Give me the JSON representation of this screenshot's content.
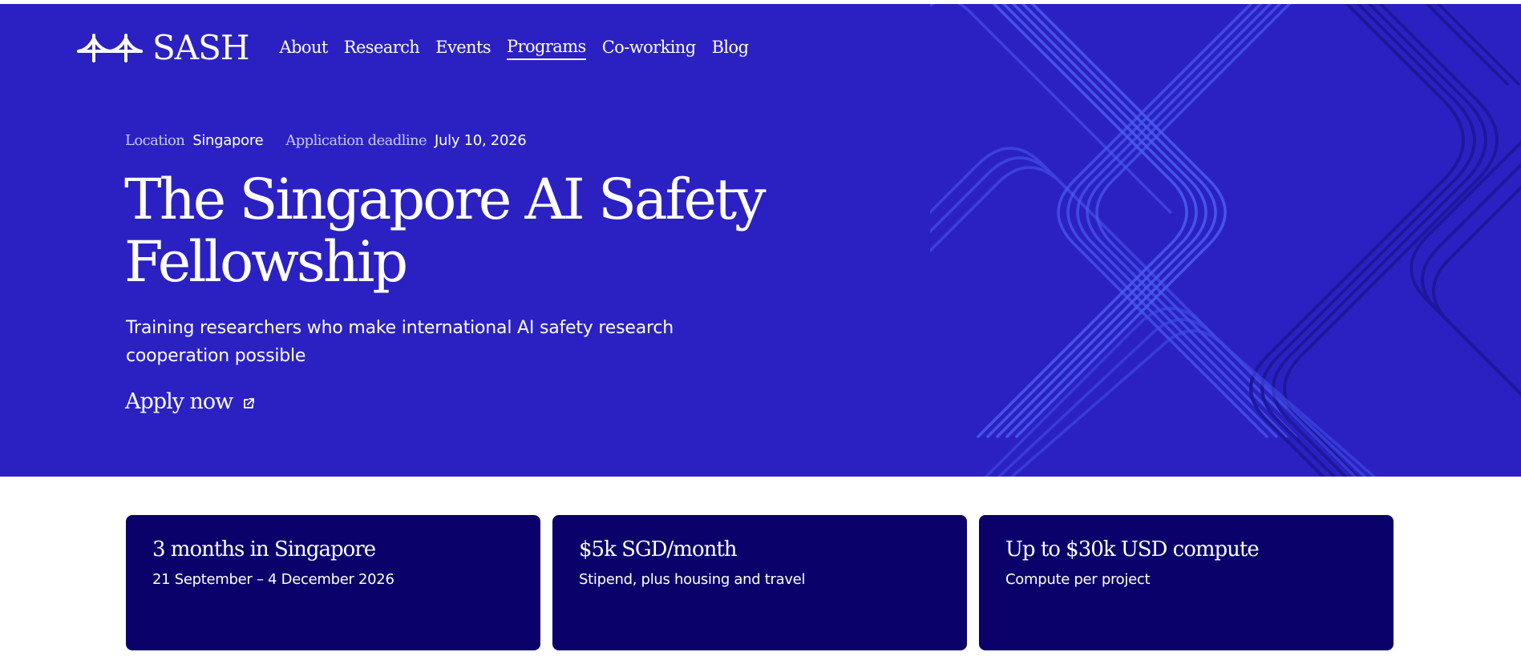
{
  "colors": {
    "hero_bg": "#2b21c3",
    "pattern_light": "#4a5cf0",
    "pattern_dark": "#1c1696",
    "card_bg": "#0a026a",
    "meta_label": "#c6c9ff",
    "text": "#ffffff"
  },
  "header": {
    "logo_icon": "bridge-logo-icon",
    "logo_text": "SASH",
    "nav": [
      {
        "label": "About",
        "active": false
      },
      {
        "label": "Research",
        "active": false
      },
      {
        "label": "Events",
        "active": false
      },
      {
        "label": "Programs",
        "active": true
      },
      {
        "label": "Co-working",
        "active": false
      },
      {
        "label": "Blog",
        "active": false
      }
    ]
  },
  "hero": {
    "meta": [
      {
        "label": "Location",
        "value": "Singapore"
      },
      {
        "label": "Application deadline",
        "value": "July 10, 2026"
      }
    ],
    "title": "The Singapore AI Safety Fellowship",
    "subtitle": "Training researchers who make international AI safety research cooperation possible",
    "cta_label": "Apply now",
    "cta_icon": "external-link-icon"
  },
  "cards": [
    {
      "title": "3 months in Singapore",
      "description": "21 September – 4 December 2026"
    },
    {
      "title": "$5k SGD/month",
      "description": "Stipend, plus housing and travel"
    },
    {
      "title": "Up to $30k USD compute",
      "description": "Compute per project"
    }
  ]
}
